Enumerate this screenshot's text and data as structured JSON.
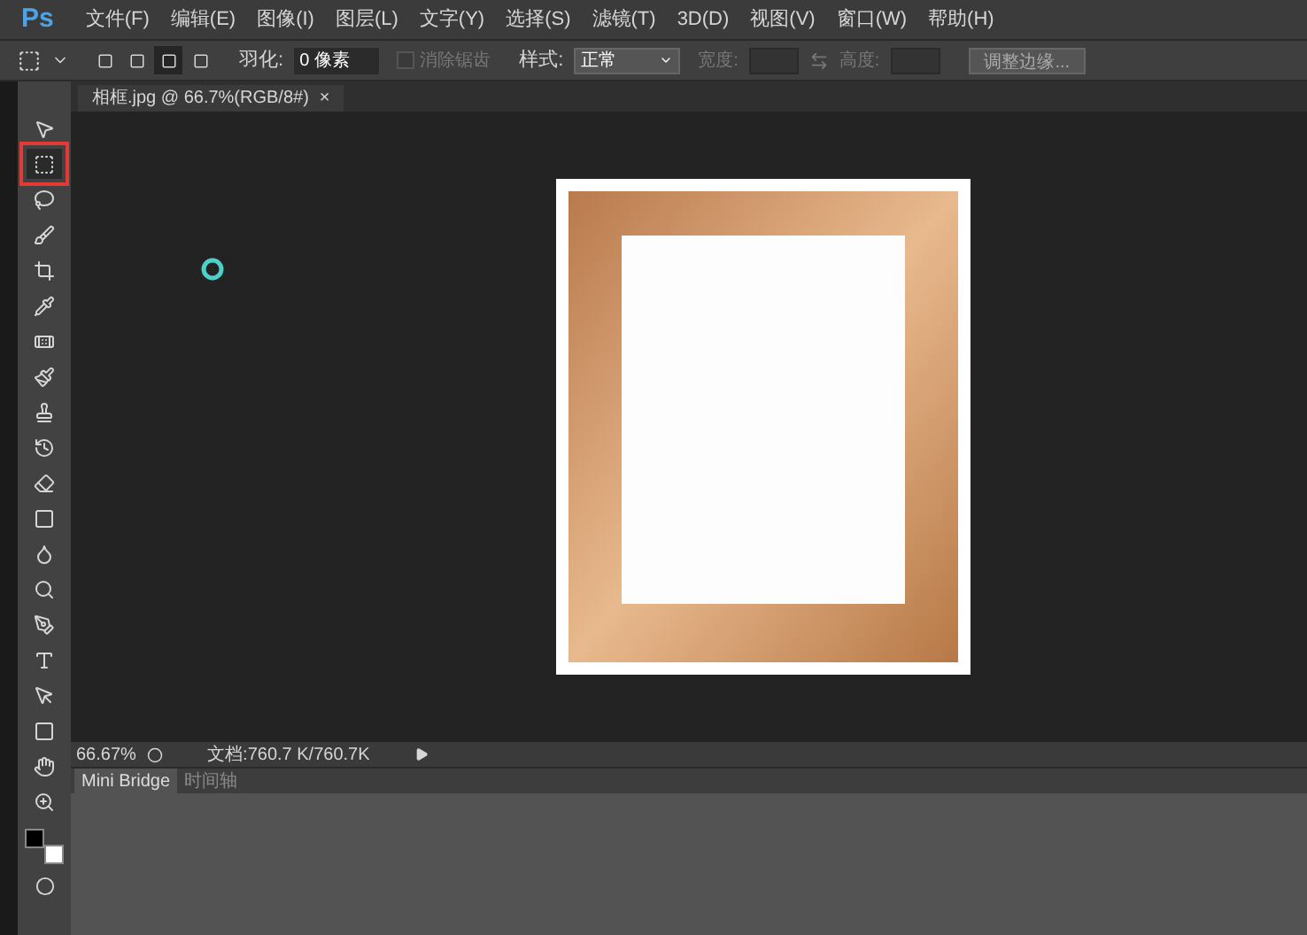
{
  "app": {
    "logo": "Ps"
  },
  "menu": [
    {
      "label": "文件(F)"
    },
    {
      "label": "编辑(E)"
    },
    {
      "label": "图像(I)"
    },
    {
      "label": "图层(L)"
    },
    {
      "label": "文字(Y)"
    },
    {
      "label": "选择(S)"
    },
    {
      "label": "滤镜(T)"
    },
    {
      "label": "3D(D)"
    },
    {
      "label": "视图(V)"
    },
    {
      "label": "窗口(W)"
    },
    {
      "label": "帮助(H)"
    }
  ],
  "options_bar": {
    "selection_modes": [
      {
        "selected": false
      },
      {
        "selected": false
      },
      {
        "selected": true
      },
      {
        "selected": false
      }
    ],
    "feather": {
      "label": "羽化:",
      "value": "0 像素"
    },
    "anti_alias": {
      "label": "消除锯齿",
      "checked": false,
      "disabled": true
    },
    "style": {
      "label": "样式:",
      "value": "正常"
    },
    "width": {
      "label": "宽度:",
      "disabled": true
    },
    "height": {
      "label": "高度:",
      "disabled": true
    },
    "refine_button": "调整边缘..."
  },
  "document_tab": {
    "title": "相框.jpg @ 66.7%(RGB/8#)",
    "close": "×"
  },
  "tools": [
    {
      "kind": "move",
      "selected": false
    },
    {
      "kind": "marquee",
      "selected": true
    },
    {
      "kind": "lasso",
      "selected": false
    },
    {
      "kind": "quick",
      "selected": false
    },
    {
      "kind": "crop",
      "selected": false
    },
    {
      "kind": "eyedropper",
      "selected": false
    },
    {
      "kind": "heal",
      "selected": false
    },
    {
      "kind": "brush",
      "selected": false
    },
    {
      "kind": "stamp",
      "selected": false
    },
    {
      "kind": "history",
      "selected": false
    },
    {
      "kind": "eraser",
      "selected": false
    },
    {
      "kind": "gradient",
      "selected": false
    },
    {
      "kind": "blur",
      "selected": false
    },
    {
      "kind": "dodge",
      "selected": false
    },
    {
      "kind": "pen",
      "selected": false
    },
    {
      "kind": "type",
      "selected": false
    },
    {
      "kind": "path",
      "selected": false
    },
    {
      "kind": "shape",
      "selected": false
    },
    {
      "kind": "hand",
      "selected": false
    },
    {
      "kind": "zoom",
      "selected": false
    }
  ],
  "status_bar": {
    "zoom": "66.67%",
    "doc_info": "文档:760.7 K/760.7K"
  },
  "panel_tabs": [
    {
      "label": "Mini Bridge",
      "selected": true
    },
    {
      "label": "时间轴",
      "selected": false
    }
  ]
}
